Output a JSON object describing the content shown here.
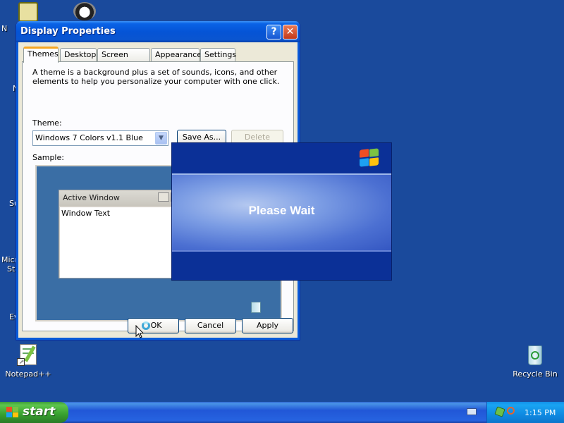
{
  "desktop": {
    "icons": [
      {
        "label": "Notepad++"
      },
      {
        "label": "Recycle Bin"
      }
    ],
    "partial_labels": [
      "N",
      "N",
      "Su",
      "Micr",
      "St",
      "Ev"
    ]
  },
  "dialog": {
    "title": "Display Properties",
    "help_glyph": "?",
    "close_glyph": "✕",
    "tabs": [
      "Themes",
      "Desktop",
      "Screen Saver",
      "Appearance",
      "Settings"
    ],
    "description": "A theme is a background plus a set of sounds, icons, and other elements to help you personalize your computer with one click.",
    "theme_label": "Theme:",
    "theme_value": "Windows 7 Colors v1.1 Blue",
    "save_as_label": "Save As...",
    "delete_label": "Delete",
    "sample_label": "Sample:",
    "sample": {
      "active_window_title": "Active Window",
      "window_text": "Window Text"
    },
    "ok_label": "OK",
    "cancel_label": "Cancel",
    "apply_label": "Apply"
  },
  "splash": {
    "message": "Please Wait"
  },
  "taskbar": {
    "start_label": "start",
    "clock": "1:15 PM"
  },
  "colors": {
    "desktop": "#1a4a9c",
    "title_bar": "#0554d6",
    "start_button": "#37a02f",
    "tray": "#0f8ae2"
  }
}
